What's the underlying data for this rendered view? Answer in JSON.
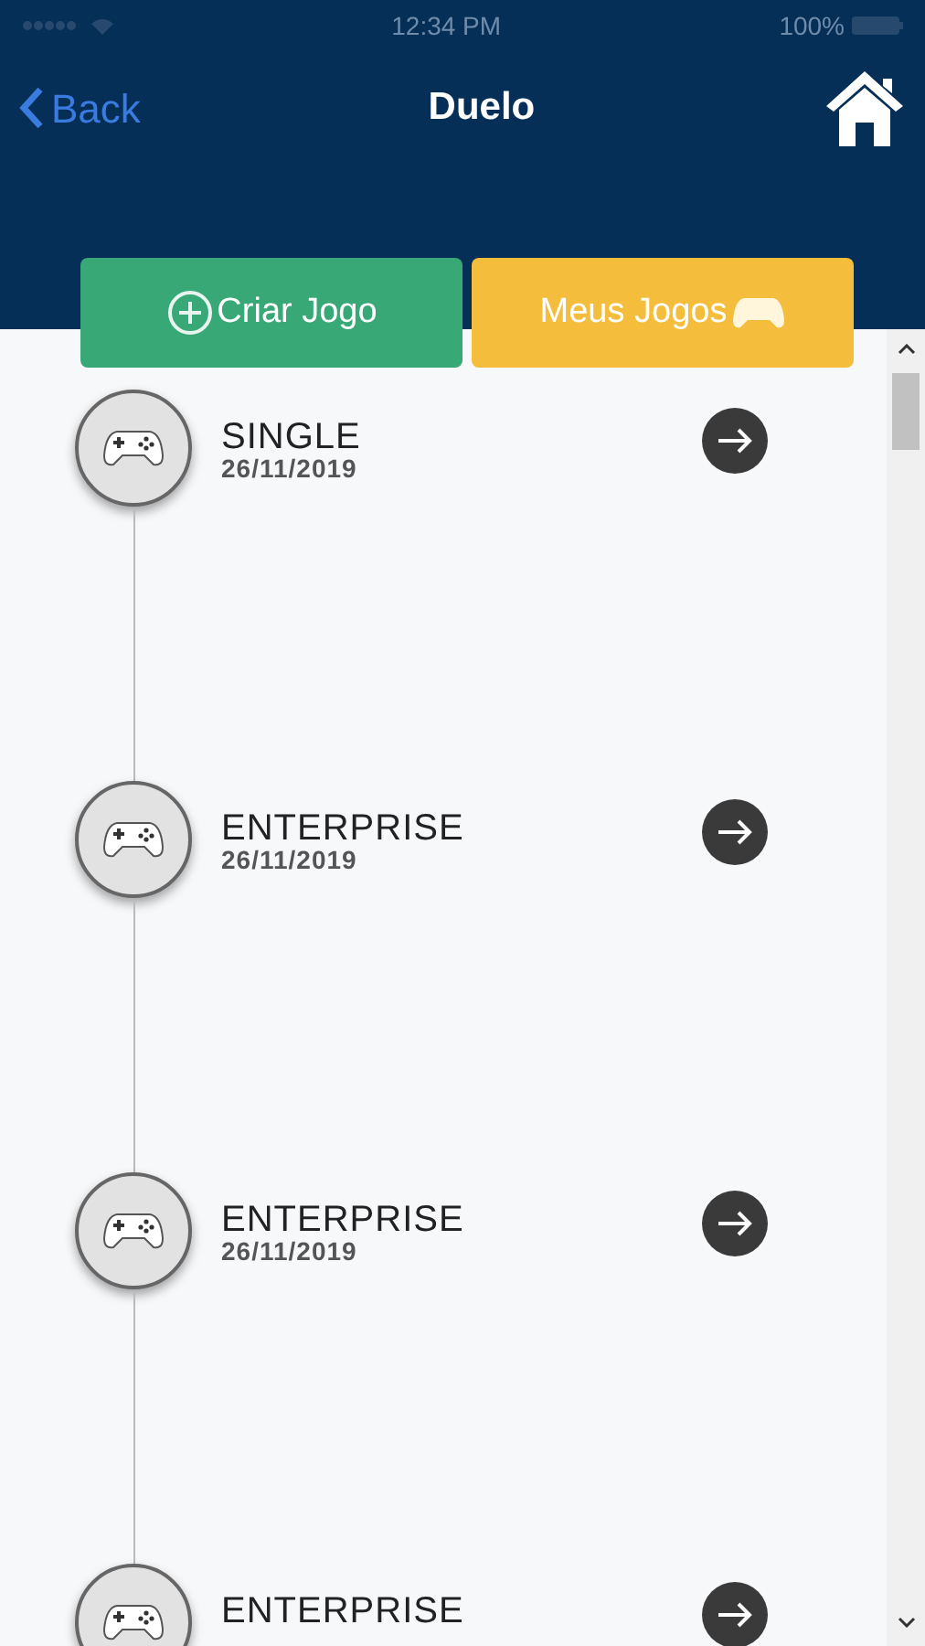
{
  "status_bar": {
    "time": "12:34 PM",
    "battery": "100%"
  },
  "nav": {
    "back": "Back",
    "title": "Duelo"
  },
  "actions": [
    {
      "kind": "create",
      "label": "Criar Jogo"
    },
    {
      "kind": "mine",
      "label": "Meus Jogos"
    }
  ],
  "games": [
    {
      "title": "SINGLE",
      "date": "26/11/2019"
    },
    {
      "title": "ENTERPRISE",
      "date": "26/11/2019"
    },
    {
      "title": "ENTERPRISE",
      "date": "26/11/2019"
    },
    {
      "title": "ENTERPRISE"
    }
  ]
}
